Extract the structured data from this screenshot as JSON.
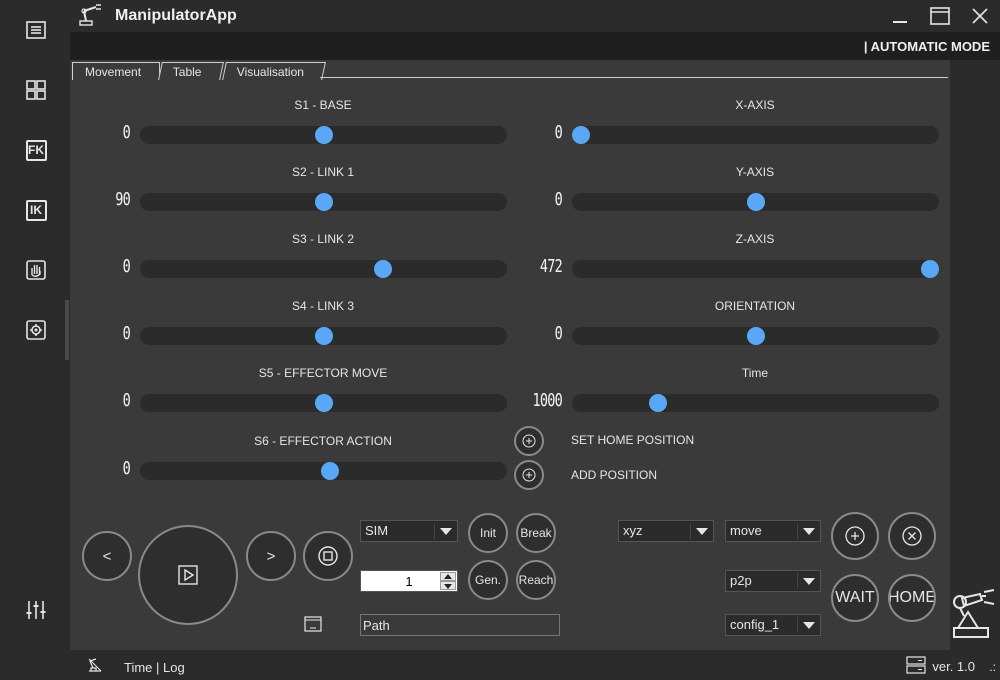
{
  "app": {
    "title": "ManipulatorApp",
    "mode": "| AUTOMATIC MODE"
  },
  "sidebar": {
    "items": [
      {
        "name": "menu",
        "label": ""
      },
      {
        "name": "dashboard",
        "label": ""
      },
      {
        "name": "fk",
        "label": "FK"
      },
      {
        "name": "ik",
        "label": "IK"
      },
      {
        "name": "manual",
        "label": ""
      },
      {
        "name": "settings",
        "label": ""
      },
      {
        "name": "sliders",
        "label": ""
      }
    ]
  },
  "tabs": [
    "Movement",
    "Table",
    "Visualisation"
  ],
  "joints": [
    {
      "label": "S1 - BASE",
      "value": "0",
      "level": 0.5
    },
    {
      "label": "S2 - LINK 1",
      "value": "90",
      "level": 0.5
    },
    {
      "label": "S3 - LINK 2",
      "value": "0",
      "level": 0.67
    },
    {
      "label": "S4 - LINK 3",
      "value": "0",
      "level": 0.5
    },
    {
      "label": "S5 - EFFECTOR MOVE",
      "value": "0",
      "level": 0.5
    },
    {
      "label": "S6 - EFFECTOR ACTION",
      "value": "0",
      "level": 0.52
    }
  ],
  "cartesian": [
    {
      "label": "X-AXIS",
      "value": "0",
      "level": 0.0
    },
    {
      "label": "Y-AXIS",
      "value": "0",
      "level": 0.5
    },
    {
      "label": "Z-AXIS",
      "value": "472",
      "level": 1.0
    },
    {
      "label": "ORIENTATION",
      "value": "0",
      "level": 0.5
    },
    {
      "label": "Time",
      "value": "1000",
      "level": 0.22
    }
  ],
  "actions": {
    "set_home": "SET HOME POSITION",
    "add_position": "ADD POSITION"
  },
  "controls": {
    "prev": "<",
    "next": ">",
    "mode_select": "SIM",
    "spin_value": "1",
    "init": "Init",
    "break": "Break",
    "gen": "Gen.",
    "reach": "Reach",
    "path": "Path",
    "coord_select": "xyz",
    "action_select": "move",
    "interp_select": "p2p",
    "config_select": "config_1",
    "wait": "WAIT",
    "home": "HOME"
  },
  "status": {
    "text": "Time | Log",
    "version": "ver. 1.0",
    "grip": ".:"
  },
  "colors": {
    "accent": "#5aa7f5",
    "background": "#2b2b2b",
    "panel": "#3a3a3a"
  }
}
